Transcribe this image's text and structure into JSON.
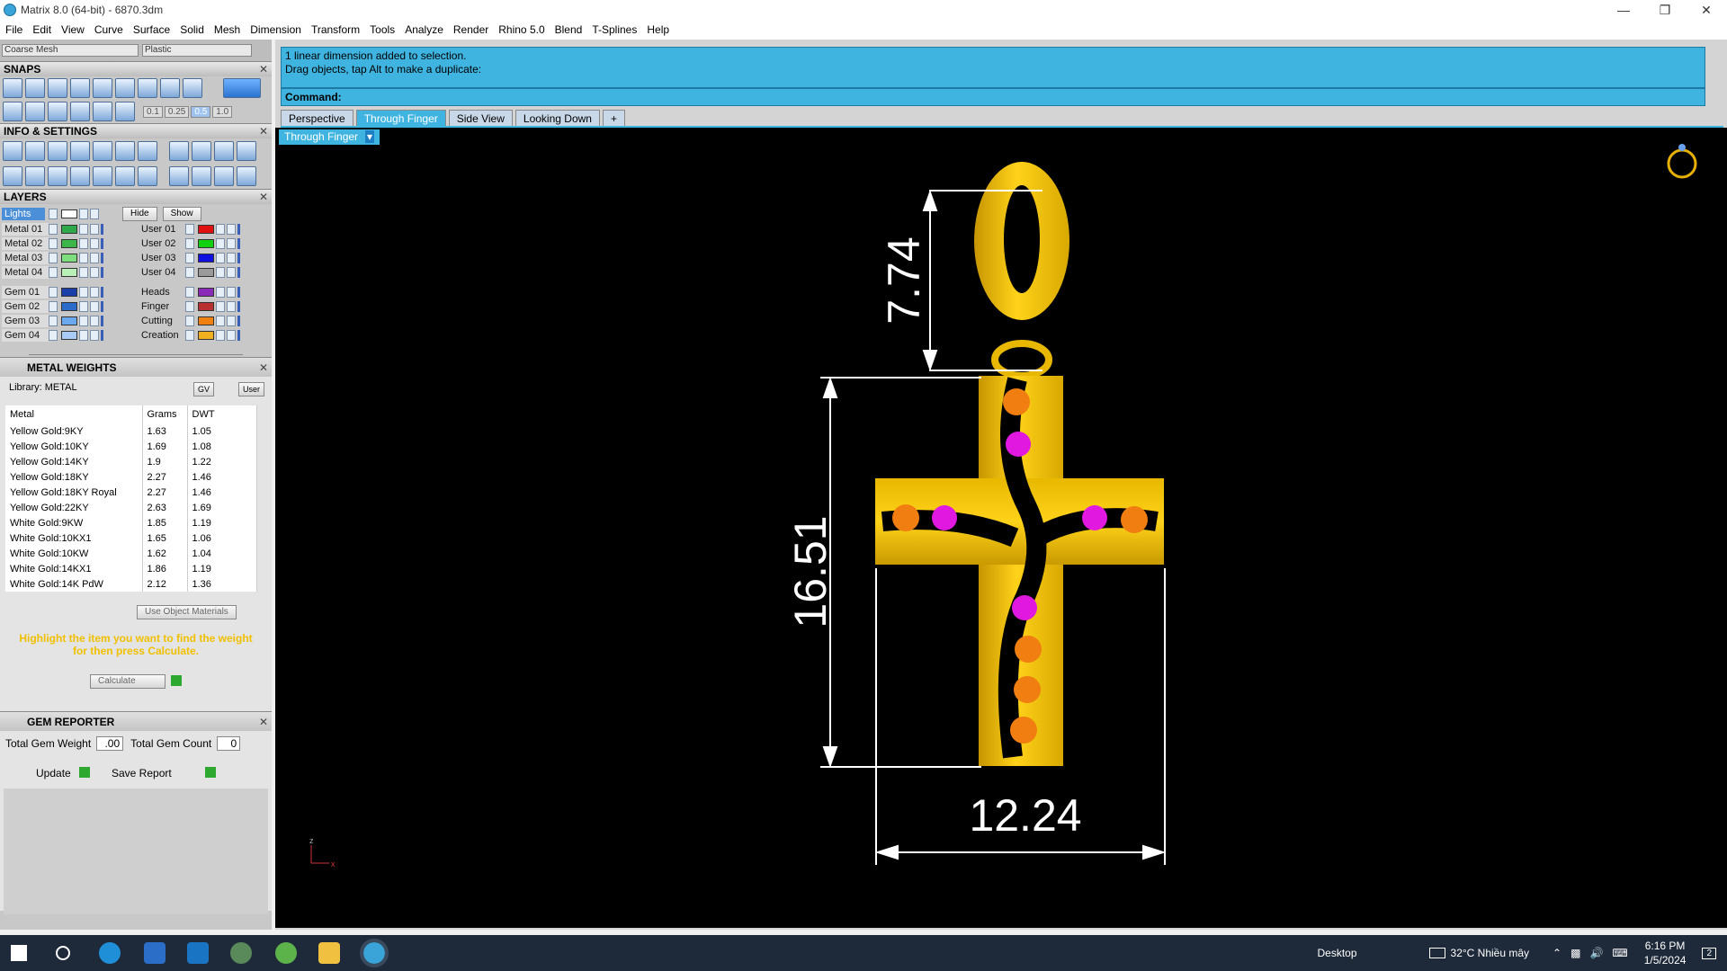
{
  "window": {
    "title": "Matrix 8.0 (64-bit) - 6870.3dm"
  },
  "menu": [
    "File",
    "Edit",
    "View",
    "Curve",
    "Surface",
    "Solid",
    "Mesh",
    "Dimension",
    "Transform",
    "Tools",
    "Analyze",
    "Render",
    "Rhino 5.0",
    "Blend",
    "T-Splines",
    "Help"
  ],
  "top_selectors": {
    "mesh": "Coarse Mesh",
    "material": "Plastic"
  },
  "snaps": {
    "title": "SNAPS",
    "values": [
      "0.1",
      "0.25",
      "0.5",
      "1.0"
    ]
  },
  "info": {
    "title": "INFO & SETTINGS"
  },
  "layers": {
    "title": "LAYERS",
    "lights": "Lights",
    "hide": "Hide",
    "show": "Show",
    "left": [
      {
        "name": "Metal 01",
        "color": "#2ea84a"
      },
      {
        "name": "Metal 02",
        "color": "#3cb54a"
      },
      {
        "name": "Metal 03",
        "color": "#7ede7e"
      },
      {
        "name": "Metal 04",
        "color": "#b8f0b8"
      },
      {
        "name": "Gem 01",
        "color": "#1a3fa8"
      },
      {
        "name": "Gem 02",
        "color": "#2a6ac8"
      },
      {
        "name": "Gem 03",
        "color": "#6aa8f0"
      },
      {
        "name": "Gem 04",
        "color": "#a8ccf6"
      }
    ],
    "right": [
      {
        "name": "User 01",
        "color": "#e01010"
      },
      {
        "name": "User 02",
        "color": "#10d010"
      },
      {
        "name": "User 03",
        "color": "#1010e0"
      },
      {
        "name": "User 04",
        "color": "#9a9a9a"
      },
      {
        "name": "Heads",
        "color": "#8a2ab8"
      },
      {
        "name": "Finger",
        "color": "#b83030"
      },
      {
        "name": "Cutting",
        "color": "#f08010"
      },
      {
        "name": "Creation",
        "color": "#f0b020"
      }
    ]
  },
  "metal_weights": {
    "title": "METAL WEIGHTS",
    "library": "Library: METAL",
    "gv": "GV",
    "user": "User",
    "columns": [
      "Metal",
      "Grams",
      "DWT"
    ],
    "rows": [
      [
        "Yellow Gold:9KY",
        "1.63",
        "1.05"
      ],
      [
        "Yellow Gold:10KY",
        "1.69",
        "1.08"
      ],
      [
        "Yellow Gold:14KY",
        "1.9",
        "1.22"
      ],
      [
        "Yellow Gold:18KY",
        "2.27",
        "1.46"
      ],
      [
        "Yellow Gold:18KY Royal",
        "2.27",
        "1.46"
      ],
      [
        "Yellow Gold:22KY",
        "2.63",
        "1.69"
      ],
      [
        "White Gold:9KW",
        "1.85",
        "1.19"
      ],
      [
        "White Gold:10KX1",
        "1.65",
        "1.06"
      ],
      [
        "White Gold:10KW",
        "1.62",
        "1.04"
      ],
      [
        "White Gold:14KX1",
        "1.86",
        "1.19"
      ],
      [
        "White Gold:14K PdW",
        "2.12",
        "1.36"
      ]
    ],
    "use_object_materials": "Use Object Materials",
    "hint": "Highlight the item you want to find the weight for then press Calculate.",
    "calculate": "Calculate"
  },
  "gem_reporter": {
    "title": "GEM REPORTER",
    "total_weight_label": "Total Gem Weight",
    "total_weight": ".00",
    "total_count_label": "Total Gem Count",
    "total_count": "0",
    "update": "Update",
    "save_report": "Save Report"
  },
  "command": {
    "line1": "1 linear dimension added to selection.",
    "line2": "Drag objects, tap Alt to make a duplicate:",
    "prompt": "Command:"
  },
  "view_tabs": [
    "Perspective",
    "Through Finger",
    "Side View",
    "Looking Down"
  ],
  "active_view": "Through Finger",
  "dimensions": {
    "loop_height": "7.74",
    "cross_height": "16.51",
    "cross_width": "12.24"
  },
  "axis": {
    "z": "z",
    "x": "x"
  },
  "taskbar": {
    "desktop": "Desktop",
    "weather": "32°C  Nhiều mây",
    "time": "6:16 PM",
    "date": "1/5/2024",
    "notifications": "2"
  }
}
